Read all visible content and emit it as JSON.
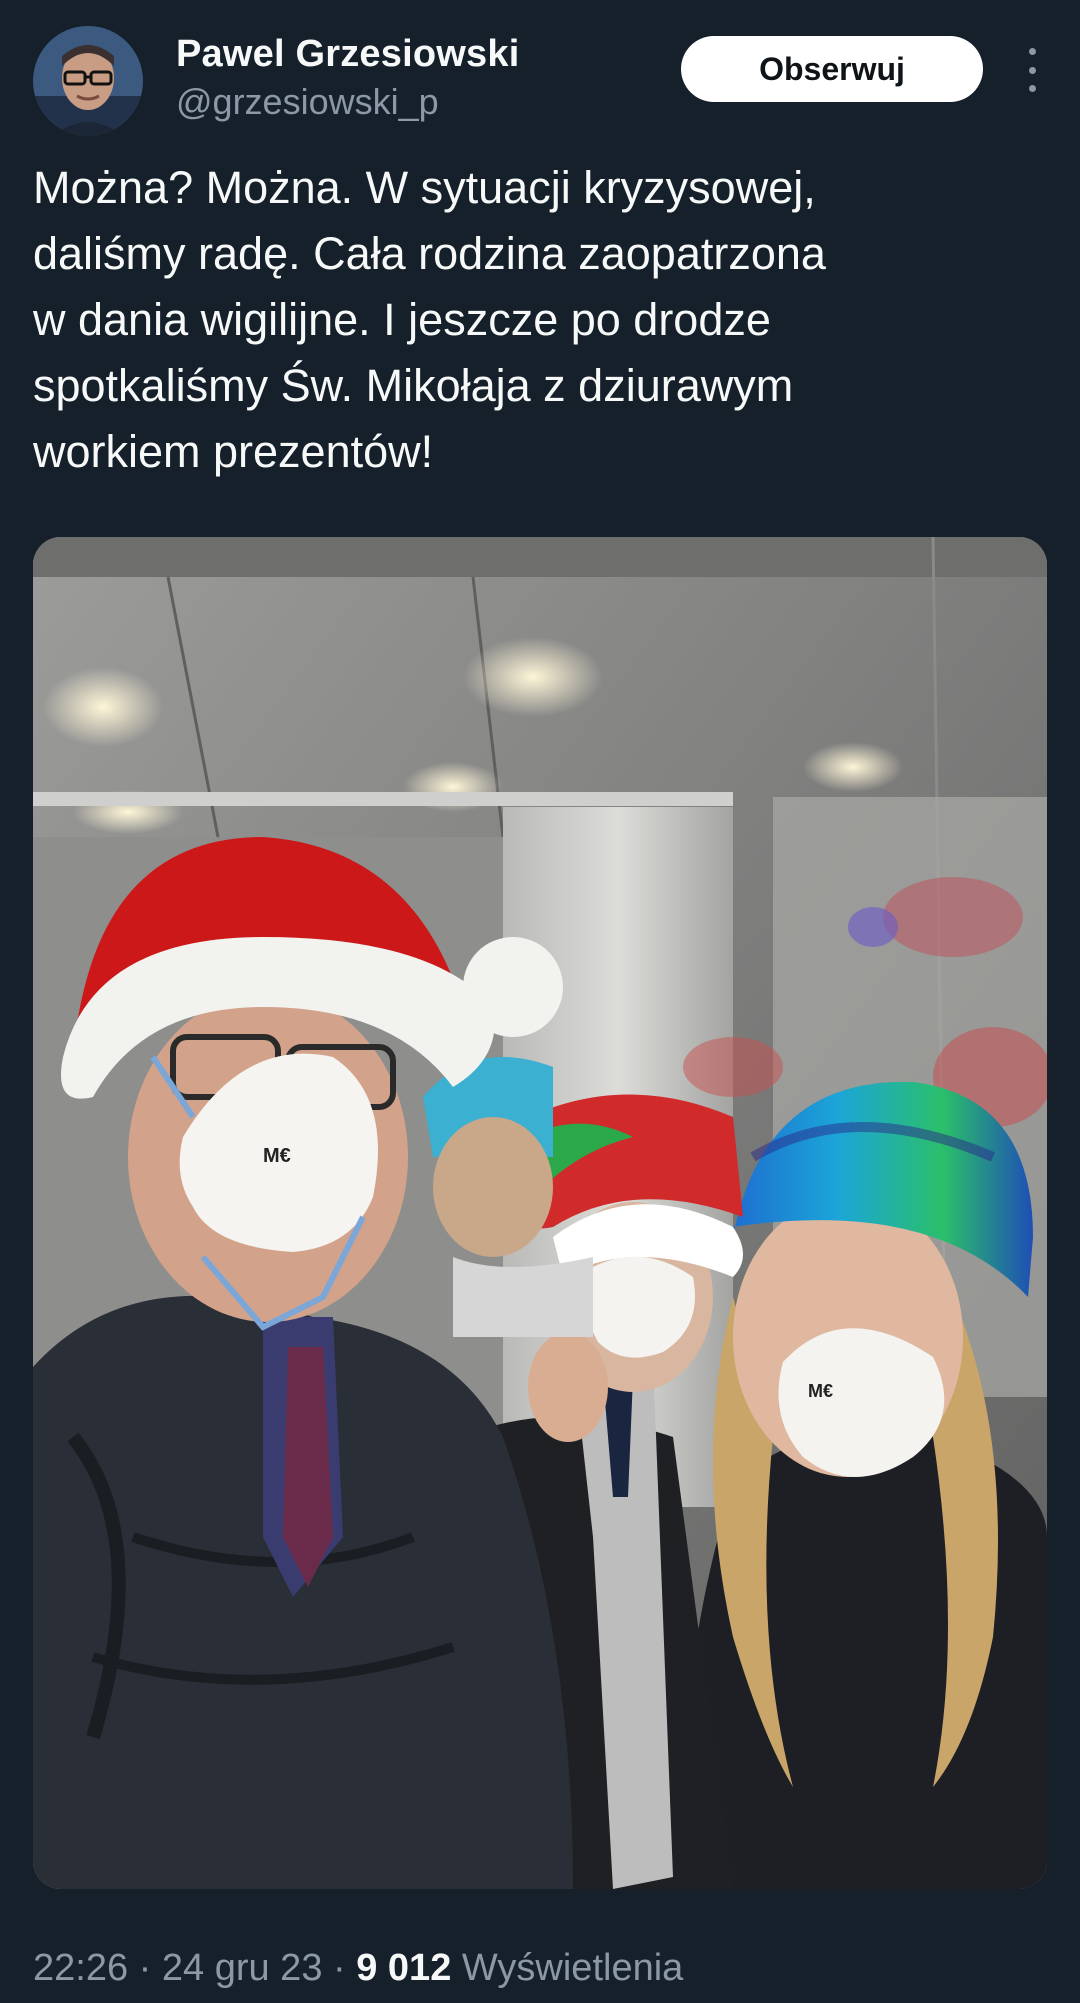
{
  "author": {
    "display_name": "Pawel Grzesiowski",
    "handle": "@grzesiowski_p",
    "avatar": "profile-photo"
  },
  "actions": {
    "follow_label": "Obserwuj",
    "more_icon": "more-vertical-icon"
  },
  "tweet": {
    "lines": [
      "Można? Można. W sytuacji kryzysowej,",
      "daliśmy radę. Cała rodzina zaopatrzona",
      "w dania wigilijne. I jeszcze po drodze",
      "spotkaliśmy Św. Mikołaja z dziurawym",
      "workiem prezentów!"
    ],
    "media": "photo-family-in-elevator-santa-hats-masks"
  },
  "meta": {
    "time": "22:26",
    "separator": "·",
    "date": "24 gru 23",
    "views_count": "9 012",
    "views_label": "Wyświetlenia"
  },
  "colors": {
    "background": "#15202b",
    "text_primary": "#f7f9f9",
    "text_secondary": "#8b98a5",
    "follow_bg": "#ffffff"
  }
}
